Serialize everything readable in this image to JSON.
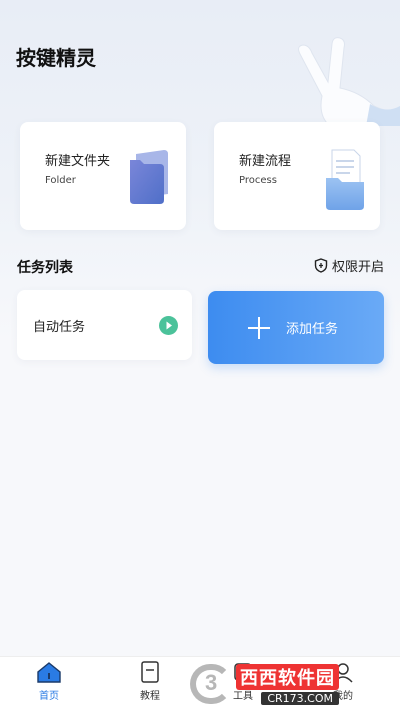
{
  "app": {
    "title": "按键精灵"
  },
  "cards": [
    {
      "title": "新建文件夹",
      "subtitle": "Folder",
      "icon": "folder-icon"
    },
    {
      "title": "新建流程",
      "subtitle": "Process",
      "icon": "document-folder-icon"
    }
  ],
  "tasks_section": {
    "title": "任务列表",
    "permission_label": "权限开启",
    "permission_icon": "shield-icon"
  },
  "tasks": [
    {
      "name": "自动任务",
      "action_icon": "play-icon"
    }
  ],
  "add_task": {
    "label": "添加任务",
    "icon": "plus-icon"
  },
  "tabbar": {
    "items": [
      {
        "label": "首页",
        "icon": "home-icon",
        "active": true
      },
      {
        "label": "教程",
        "icon": "book-icon",
        "active": false
      },
      {
        "label": "工具",
        "icon": "tools-icon",
        "active": false
      },
      {
        "label": "我的",
        "icon": "user-icon",
        "active": false
      }
    ]
  },
  "watermark": {
    "brand": "西西软件园",
    "url": "CR173.COM"
  },
  "colors": {
    "accent": "#3d8cf0",
    "play": "#4bc29a",
    "background": "#f7f8fb"
  }
}
